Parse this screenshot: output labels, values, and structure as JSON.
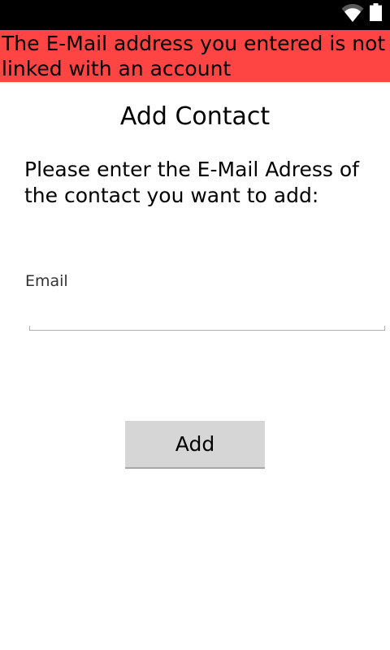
{
  "status_bar": {
    "icons": [
      "wifi-icon",
      "battery-icon"
    ]
  },
  "error_banner": {
    "message": "The E-Mail address you entered is not linked with an account",
    "color": "#ff4444"
  },
  "page": {
    "title": "Add Contact",
    "instructions": "Please enter the E-Mail Adress of the contact you want to add:"
  },
  "form": {
    "email_label": "Email",
    "email_value": "",
    "email_placeholder": ""
  },
  "actions": {
    "add_label": "Add"
  }
}
